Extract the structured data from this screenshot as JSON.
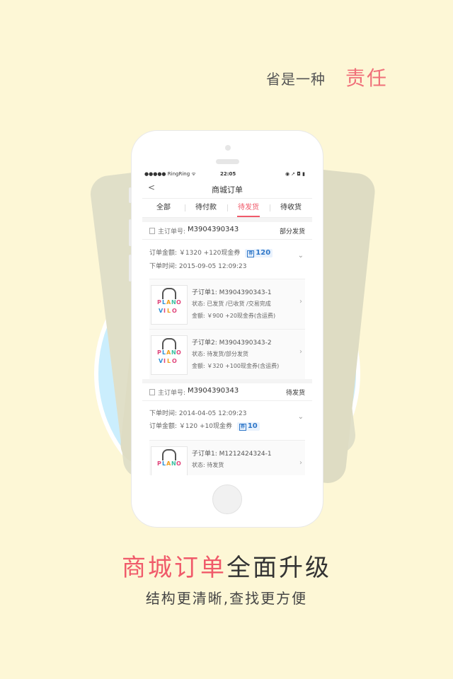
{
  "tagline": {
    "part1": "省是一种",
    "part2": "责任"
  },
  "status_bar": {
    "carrier": "●●●●● RingRing ᯤ",
    "time": "22:05",
    "icons": "◉ ➚ ◘ ▮"
  },
  "nav": {
    "back_icon": "<",
    "title": "商城订单"
  },
  "tabs": [
    {
      "label": "全部"
    },
    {
      "label": "待付款"
    },
    {
      "label": "待发货"
    },
    {
      "label": "待收货"
    }
  ],
  "orders": [
    {
      "order_label": "主订单号:",
      "order_no": "M3904390343",
      "status": "部分发货",
      "amount_label": "订单金额:",
      "amount": "￥1320 +120现金券",
      "badge": "120",
      "time_label": "下单时间:",
      "time": "2015-09-05 12:09:23",
      "subs": [
        {
          "id": "子订单1:  M3904390343-1",
          "state": "状态:   已发货 /已收货 /交易完成",
          "money": "金额:   ￥900 +20现金券(含运费)"
        },
        {
          "id": "子订单2:  M3904390343-2",
          "state": "状态:   待发货/部分发货",
          "money": "金额:   ￥320 +100现金券(含运费)"
        }
      ]
    },
    {
      "order_label": "主订单号:",
      "order_no": "M3904390343",
      "status": "待发货",
      "amount_label": "订单金额:",
      "amount": "￥120 +10现金券",
      "badge": "10",
      "time_label": "下单时间:",
      "time": "2014-04-05 12:09:23",
      "subs": [
        {
          "id": "子订单1:  M1212424324-1",
          "state": "状态:   待发货",
          "money": ""
        }
      ]
    }
  ],
  "headline": {
    "highlight": "商城订单",
    "rest": "全面升级"
  },
  "subheadline": "结构更清晰,查找更方便",
  "colors": {
    "accent": "#f05a6a",
    "background": "#fdf7d6",
    "circle": "#cbeefd",
    "badge": "#2f77c8"
  }
}
